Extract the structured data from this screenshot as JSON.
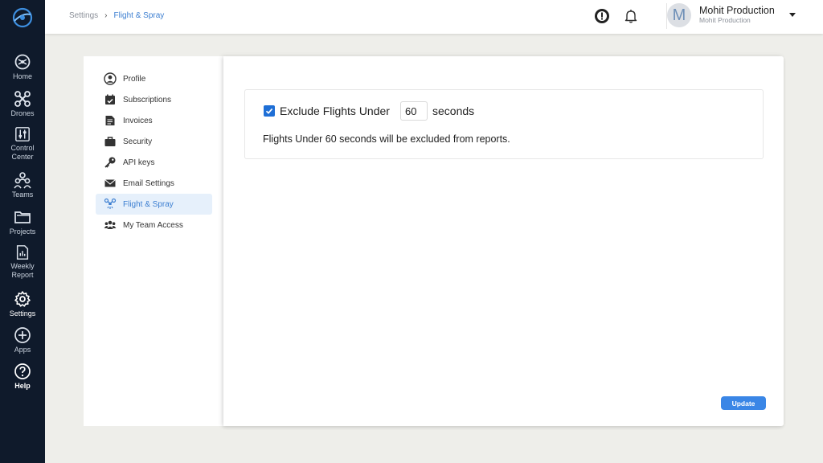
{
  "rail": {
    "items": [
      {
        "label": "Home",
        "icon": "drone-home-icon"
      },
      {
        "label": "Drones",
        "icon": "drone-icon"
      },
      {
        "label": "Control\nCenter",
        "icon": "control-center-icon"
      },
      {
        "label": "Teams",
        "icon": "teams-icon"
      },
      {
        "label": "Projects",
        "icon": "folder-icon"
      },
      {
        "label": "Weekly\nReport",
        "icon": "report-icon"
      },
      {
        "label": "Settings",
        "icon": "gear-icon"
      },
      {
        "label": "Apps",
        "icon": "plus-circle-icon"
      },
      {
        "label": "Help",
        "icon": "help-circle-icon"
      }
    ]
  },
  "breadcrumb": {
    "root": "Settings",
    "separator": "›",
    "current": "Flight & Spray"
  },
  "user": {
    "initial": "M",
    "name": "Mohit Production",
    "subtitle": "Mohit Production"
  },
  "menu": {
    "items": [
      {
        "label": "Profile",
        "icon": "user-circle-icon"
      },
      {
        "label": "Subscriptions",
        "icon": "calendar-check-icon"
      },
      {
        "label": "Invoices",
        "icon": "invoice-icon"
      },
      {
        "label": "Security",
        "icon": "briefcase-icon"
      },
      {
        "label": "API keys",
        "icon": "key-icon"
      },
      {
        "label": "Email Settings",
        "icon": "envelope-icon"
      },
      {
        "label": "Flight & Spray",
        "icon": "drone-spray-icon"
      },
      {
        "label": "My Team Access",
        "icon": "users-icon"
      }
    ],
    "active": "Flight & Spray"
  },
  "flight_settings": {
    "exclude_checked": true,
    "exclude_label": "Exclude Flights Under",
    "seconds_value": "60",
    "unit_label": "seconds",
    "description": "Flights Under 60 seconds will be excluded from reports."
  },
  "actions": {
    "update_label": "Update"
  },
  "colors": {
    "rail_bg": "#0f1a2b",
    "accent": "#3d7fd1",
    "checkbox": "#1f6fd6",
    "button": "#3a86e6",
    "page_bg": "#eeeeea"
  }
}
